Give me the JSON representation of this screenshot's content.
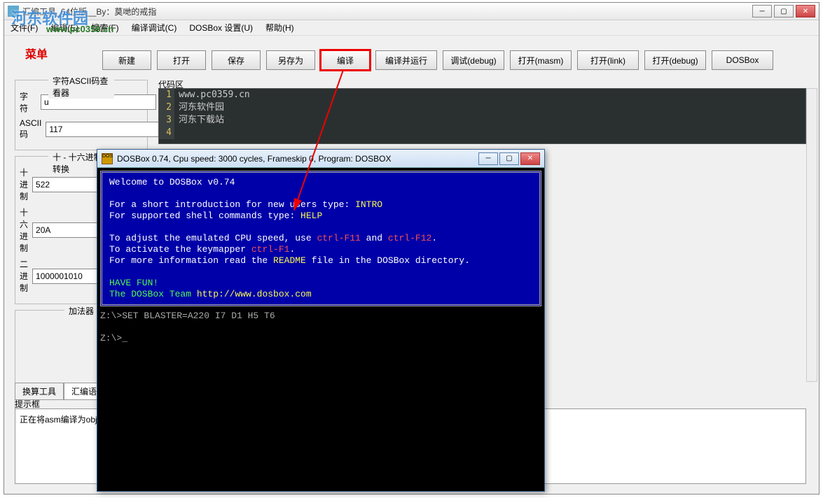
{
  "window": {
    "title": "汇编工具_64位版__By：莫哋的戒指",
    "watermark": "河东软件园",
    "watermark_url": "www.pc0359.cn"
  },
  "menu": {
    "file": "文件(F)",
    "edit": "编辑(E)",
    "search": "搜索(F)",
    "compile_debug": "编译调试(C)",
    "dosbox": "DOSBox 设置(U)",
    "help": "帮助(H)"
  },
  "menu_label": "菜单",
  "toolbar": {
    "new": "新建",
    "open": "打开",
    "save": "保存",
    "saveas": "另存为",
    "compile": "编译",
    "compile_run": "编译并运行",
    "debug": "调试(debug)",
    "open_masm": "打开(masm)",
    "open_link": "打开(link)",
    "open_debug": "打开(debug)",
    "dosbox": "DOSBox"
  },
  "ascii_panel": {
    "title": "字符ASCII码查看器",
    "char_label": "字　符",
    "char_value": "u",
    "code_label": "ASCII码",
    "code_value": "117"
  },
  "radix_panel": {
    "title": "十 - 十六进制转换",
    "dec_label": "十 进 制",
    "dec_value": "522",
    "hex_label": "十六进制",
    "hex_value": "20A",
    "bin_label": "二 进 制",
    "bin_value": "1000001010"
  },
  "adder_panel": {
    "title": "加法器"
  },
  "tabs": {
    "convert": "换算工具",
    "syntax": "汇编语法"
  },
  "code_area": {
    "label": "代码区",
    "lines": [
      "www.pc0359.cn",
      "河东软件园",
      "河东下载站",
      ""
    ]
  },
  "hint": {
    "label": "提示框",
    "text": "正在将asm编译为obj"
  },
  "dosbox": {
    "title": "DOSBox 0.74, Cpu speed:     3000 cycles, Frameskip  0, Program:    DOSBOX",
    "icon": "DOS",
    "welcome": "Welcome to DOSBox v0.74",
    "intro1a": "For a short introduction for new users type: ",
    "intro1b": "INTRO",
    "intro2a": "For supported shell commands type: ",
    "intro2b": "HELP",
    "cpu1a": "To adjust the emulated CPU speed, use ",
    "cpu1b": "ctrl-F11",
    "cpu1c": " and ",
    "cpu1d": "ctrl-F12",
    "cpu1e": ".",
    "cpu2a": "To activate the keymapper ",
    "cpu2b": "ctrl-F1",
    "cpu2c": ".",
    "cpu3a": "For more information read the ",
    "cpu3b": "README",
    "cpu3c": " file in the DOSBox directory.",
    "fun": "HAVE FUN!",
    "team": "The DOSBox Team ",
    "url": "http://www.dosbox.com",
    "prompt1": "Z:\\>SET BLASTER=A220 I7 D1 H5 T6",
    "prompt2": "Z:\\>_"
  }
}
